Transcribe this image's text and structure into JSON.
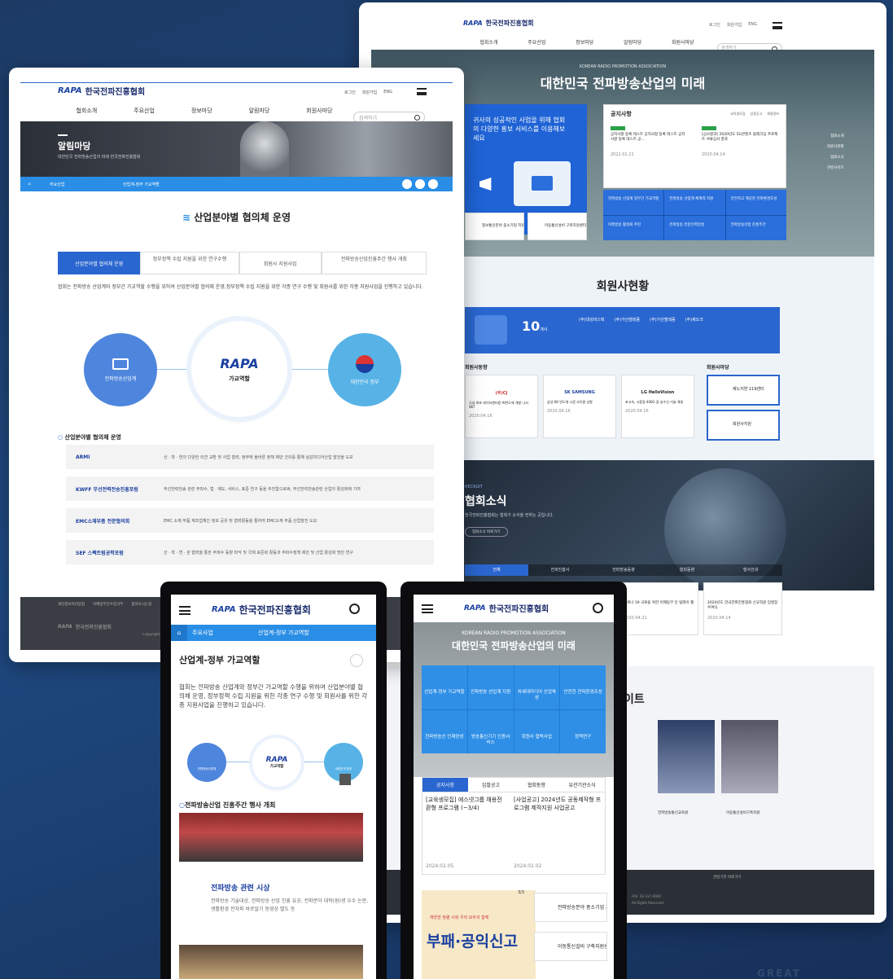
{
  "brand": {
    "mark": "RAPA",
    "name": "한국전파진흥협회"
  },
  "gnb": [
    "협회소개",
    "주요산업",
    "정보마당",
    "알림마당",
    "회원사마당"
  ],
  "util": [
    "로그인",
    "회원가입",
    "ENG"
  ],
  "search_placeholder": "검색하기",
  "sub": {
    "hero_title": "알림마당",
    "hero_sub": "대한민국 전파방송산업의 미래 한국전파진흥협회",
    "crumb": [
      "주요산업",
      "산업계-정부 가교역할"
    ],
    "section_title": "산업분야별 협의체 운영",
    "tabs": [
      "산업분야별 협의체 운영",
      "정부정책 수립 지원을 위한 연구수행",
      "회원사 지원사업",
      "전파방송산업진흥주간 행사 개최"
    ],
    "desc": "협회는 전파방송 산업계와 정부간 가교역할 수행을 위하여 산업분야별 협의체 운영,정부정책 수립 지원을 위한 각종 연구 수행 및 회원사를 위한 각종 지원사업을 진행하고 있습니다.",
    "diagram": {
      "left": "전파방송산업계",
      "center": "가교역할",
      "right": "대한민국 정부"
    },
    "list_title": "산업분야별 협의체 운영",
    "orgs": [
      {
        "name": "ARMI",
        "desc": "산 · 학 · 연의 다양한 의견 교환 및 사업 협력, 정부에 올바른 정책 제안 건의를 통해 실감미디어산업 발전을 도모"
      },
      {
        "name": "KWFF 무선전력전송진흥포럼",
        "desc": "무선전력전송 관련 주파수, 법 · 제도, 서비스, 표준 연구 등을 추진함으로써, 무선전력전송관련 산업의 활성화에 기여"
      },
      {
        "name": "EMC소재부품 전문협의회",
        "desc": "EMC 소재 부품 제조업체간 정보 공유 및 협력활동을 통하여 EMC소재 부품 산업발전 도모"
      },
      {
        "name": "SEF 스펙트럼공학포럼",
        "desc": "산 · 학 · 연 · 관 협력을 통한 주파수 동향 파악 및 국제 표준화 활동과 주파수정책 제안 및 산업 활성화 방안 연구"
      }
    ],
    "footer_links": [
      "개인정보처리방침",
      "이메일무단수집거부",
      "찾아오시는길"
    ],
    "footer_copy": "Copyright"
  },
  "main": {
    "tagline_en": "KOREAN RADIO PROMOTION ASSOCIATION",
    "tagline": "대한민국 전파방송산업의 미래",
    "promo": "귀사의 성공적인 사업을 위해 협회의 다양한 홍보 서비스를 이용해보세요",
    "promo_small": [
      "정보통신분야 중소기업 지원",
      "이동통신설비 구축지원센터"
    ],
    "notice_title": "공지사항",
    "notice_tabs": [
      "교육생모집",
      "입찰공고",
      "채용정보"
    ],
    "notices": [
      {
        "title": "공지사항 등록 테스트 공지사항 등록 테스트 공지사항 등록 테스트 공…",
        "date": "2022.01.21"
      },
      {
        "title": "[심사결과] 2020년도 5G콘텐츠 블레크십 프로젝트 서류심사 결과",
        "date": "2020.04.14"
      }
    ],
    "quick": [
      "전파방송 산업계 정부간 가교역할",
      "전파방송 산업계 체계적 지원",
      "안전하고 깨끗한 전파환경조성",
      "미래방송 활성화 추진",
      "전파방송 전문인력양성",
      "전파방송산업 진흥주간"
    ],
    "members_title": "회원사현황",
    "members_count": "10",
    "members_unit": "개사",
    "member_names": [
      "(주)대성비스텍",
      "(주)가산텔레콤",
      "(주)가산텔레콤",
      "(주)제오크"
    ],
    "member_news_title": "회원사동향",
    "member_news": [
      {
        "logo": "(주)CJ",
        "text": "국내 최초 데이터센터용 AI반도체 개발 나서 SKT",
        "date": "2020.04.16"
      },
      {
        "logo": "SK SAMSUNG",
        "text": "삼성-SK 반도체 시장 사이클 상향",
        "date": "2020.04.16"
      },
      {
        "logo": "LG HelloVision",
        "text": "초고속, 고품질 400G 광 송수신 기술 개발",
        "date": "2020.04.16"
      }
    ],
    "member_square_title": "회원사마당",
    "member_square": [
      "제노지연 119센터",
      "회원사지원"
    ],
    "news_en": "RECRUIT",
    "news_title": "협회소식",
    "news_desc": "한국전파진흥협회는 협회가 소식을 전하는 곳입니다.",
    "news_btn": "협회소식 바로가기",
    "news_tabs": [
      "전체",
      "전파진흥사",
      "전파방송동향",
      "협회동향",
      "행사안내"
    ],
    "news_cards": [
      {
        "title": "코로나 19 극복을 위한 어깨동무 인 릴레이 챌린 ",
        "date": "2020.04.21"
      },
      {
        "title": "2020년도 한국전파진흥협회 신규직원 임명장 수여식",
        "date": "2020.04.14"
      }
    ],
    "sites_title": "이트",
    "sites": [
      "전파방송통신교육원",
      "이동통신설비구축지원"
    ],
    "side_nav": [
      "협회소개",
      "회원사현황",
      "협회소식",
      "관련사이트"
    ],
    "footer_family": "관련기관 바로가기",
    "footer_fax": "FAX. 02-317-0000",
    "footer_rights": "All Rights Reserved."
  },
  "mobile1": {
    "crumb": [
      "주요사업",
      "산업계-정부 가교역할"
    ],
    "title": "산업계-정부 가교역할",
    "desc": "협회는 전파방송 산업계와 정부간 가교역할 수행을 위하여 산업분야별 협의체 운영, 정부정책 수립 지원을 위한 각종 연구 수행 및 회원사를 위한 각종 지원사업을 진행하고 있습니다.",
    "diagram": {
      "left": "전파방송산업계",
      "center": "가교역할",
      "right": "대한민국 정부"
    },
    "sec_title": "전파방송산업 진흥주간 행사 개최",
    "card_title": "전파방송 관련 시상",
    "card_desc": "전파방송 기술대상, 전파방송 산업 진흥 유공, 전파분야 대학(원)생 우수 논문, 생활환경 전자파 바로알기 동영상 별도 등"
  },
  "mobile2": {
    "tagline_en": "KOREAN RADIO PROMOTION ASSOCIATION",
    "tagline": "대한민국 전파방송산업의 미래",
    "tiles": [
      "산업계-정부 가교역할",
      "전파방송 산업계 지원",
      "차세대미디어 산업육성",
      "안전한 전파환경조성",
      "전파방송신 인재양성",
      "방송통신기기 인증서비스",
      "회원사 협력사업",
      "정책연구"
    ],
    "tabs": [
      "공지사항",
      "입찰공고",
      "협회동향",
      "유관기관소식"
    ],
    "notices": [
      {
        "title": "[교육생모집] 에스넷그룹 채용전환형 프로그램 (~3/4)",
        "date": "2024.02.05"
      },
      {
        "title": "[사업공고] 2024년도 공동제작형 프로그램 제작지원 사업공고",
        "date": "2024.02.02"
      }
    ],
    "banner_small": "깨끗한 청렴 사회 우리 모두의 함께",
    "banner": "부패·공익신고",
    "banner_page": "3/3",
    "side_links": [
      "전파방송분야 중소기업 지원",
      "이동통신설비 구축지원센터"
    ]
  },
  "watermark": "GREAT"
}
